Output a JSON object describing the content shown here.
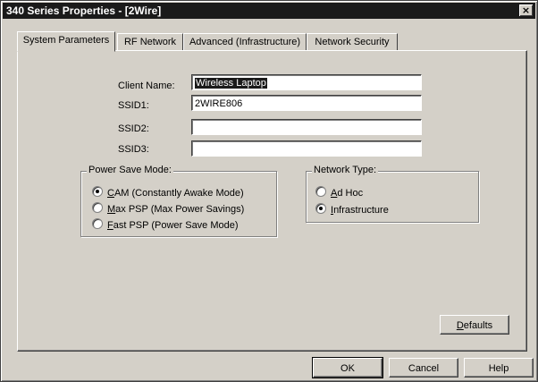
{
  "window": {
    "title": "340 Series Properties - [2Wire]",
    "close_glyph": "×"
  },
  "tabs": [
    {
      "label": "System Parameters",
      "active": true
    },
    {
      "label": "RF Network",
      "active": false
    },
    {
      "label": "Advanced (Infrastructure)",
      "active": false
    },
    {
      "label": "Network Security",
      "active": false
    }
  ],
  "fields": {
    "client_name": {
      "label": "Client Name:",
      "value": "Wireless Laptop"
    },
    "ssid1": {
      "label": "SSID1:",
      "value": "2WIRE806"
    },
    "ssid2": {
      "label": "SSID2:",
      "value": ""
    },
    "ssid3": {
      "label": "SSID3:",
      "value": ""
    }
  },
  "power_save": {
    "legend": "Power Save Mode:",
    "options": [
      {
        "accel": "C",
        "rest": "AM (Constantly Awake Mode)",
        "selected": true
      },
      {
        "accel": "M",
        "rest": "ax PSP (Max Power Savings)",
        "selected": false
      },
      {
        "accel": "F",
        "rest": "ast PSP (Power Save Mode)",
        "selected": false
      }
    ]
  },
  "network_type": {
    "legend": "Network Type:",
    "options": [
      {
        "accel": "A",
        "rest": "d Hoc",
        "selected": false
      },
      {
        "accel": "I",
        "rest": "nfrastructure",
        "selected": true
      }
    ]
  },
  "buttons": {
    "defaults": {
      "accel": "D",
      "rest": "efaults"
    },
    "ok": "OK",
    "cancel": "Cancel",
    "help": "Help"
  }
}
